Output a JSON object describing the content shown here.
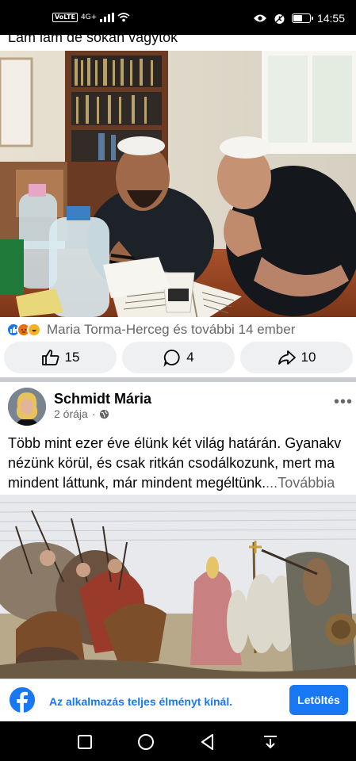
{
  "status_bar": {
    "network_label": "VoLTE",
    "signal_label": "4G+",
    "time": "14:55",
    "icons": [
      "volte-icon",
      "signal-icon",
      "wifi-icon",
      "eye-icon",
      "alarm-icon",
      "battery-icon"
    ],
    "battery_level": 0.6
  },
  "post1": {
    "caption": "Lam lam de sokan vagytok",
    "image_alt": "Two men studying a book at a table",
    "reactions": {
      "icons": [
        "like-icon",
        "angry-icon",
        "haha-icon"
      ],
      "text": "Maria Torma-Herceg és további 14 ember"
    },
    "actions": [
      {
        "name": "like",
        "icon": "thumbs-up-icon",
        "count": "15"
      },
      {
        "name": "comment",
        "icon": "comment-icon",
        "count": "4"
      },
      {
        "name": "share",
        "icon": "share-icon",
        "count": "10"
      }
    ]
  },
  "post2": {
    "author": "Schmidt Mária",
    "time": "2 órája",
    "privacy_icon": "globe-icon",
    "more_label": "•••",
    "text_lines": [
      "Több mint ezer éve élünk két világ határán. Gyanakv",
      "nézünk körül, és csak ritkán csodálkozunk, mert ma",
      "mindent láttunk, már mindent megéltünk."
    ],
    "ellipsis": "...",
    "more_link": "Továbbia",
    "image_alt": "Historical engraving of a battle with horsemen and a bishop"
  },
  "app_banner": {
    "text": "Az alkalmazás teljes élményt kínál.",
    "button": "Letöltés",
    "colors": {
      "brand": "#1877f2"
    }
  },
  "nav_bar": {
    "icons": [
      "recents-square-icon",
      "home-circle-icon",
      "back-triangle-icon",
      "notification-pull-icon"
    ]
  }
}
